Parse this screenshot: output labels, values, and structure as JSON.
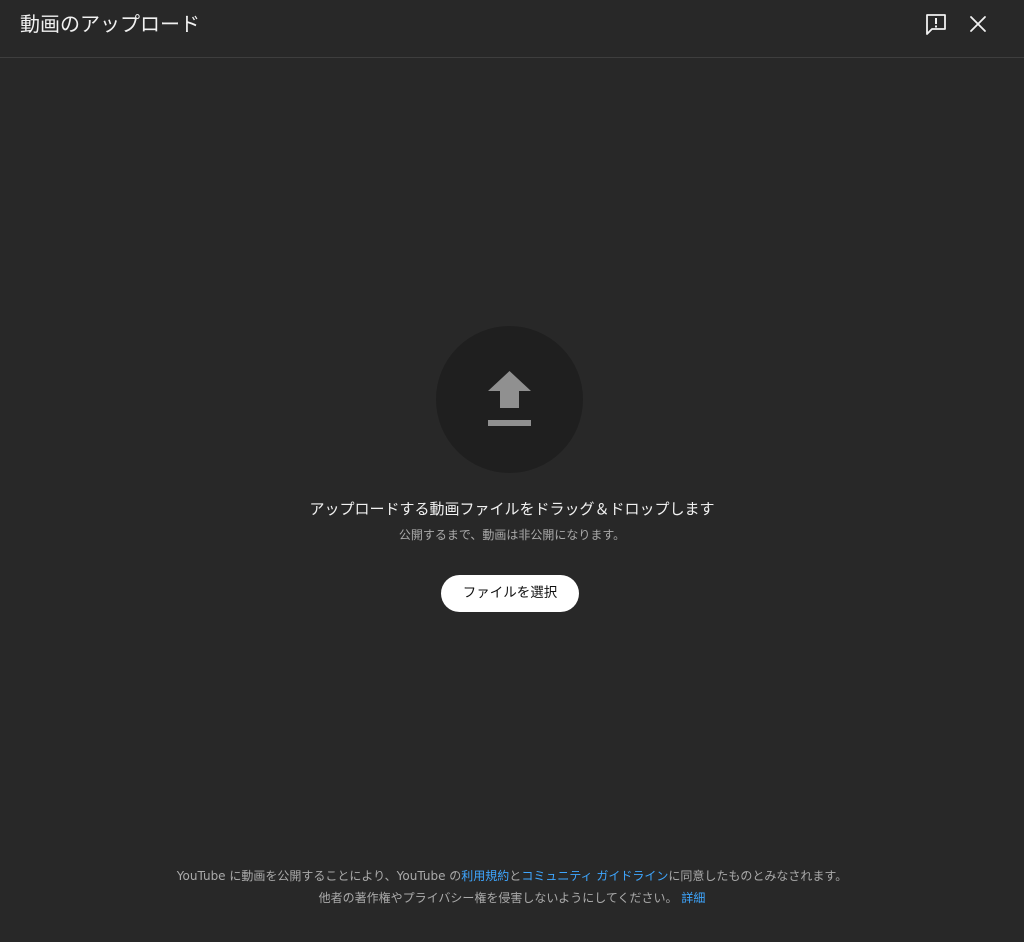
{
  "header": {
    "title": "動画のアップロード",
    "feedback_icon": "feedback-icon",
    "close_icon": "close-icon"
  },
  "main": {
    "upload_icon": "upload-arrow-icon",
    "drop_text": "アップロードする動画ファイルをドラッグ＆ドロップします",
    "private_note": "公開するまで、動画は非公開になります。",
    "select_button": "ファイルを選択"
  },
  "footer": {
    "line1_a": "YouTube に動画を公開することにより、YouTube の",
    "terms_link": "利用規約",
    "line1_b": "と",
    "guidelines_link": "コミュニティ ガイドライン",
    "line1_c": "に同意したものとみなされます。",
    "line2": "他者の著作権やプライバシー権を侵害しないようにしてください。",
    "details_link": "詳細"
  },
  "colors": {
    "background": "#282828",
    "circle": "#1f1f1f",
    "link": "#3ea6ff",
    "button_bg": "#ffffff"
  }
}
